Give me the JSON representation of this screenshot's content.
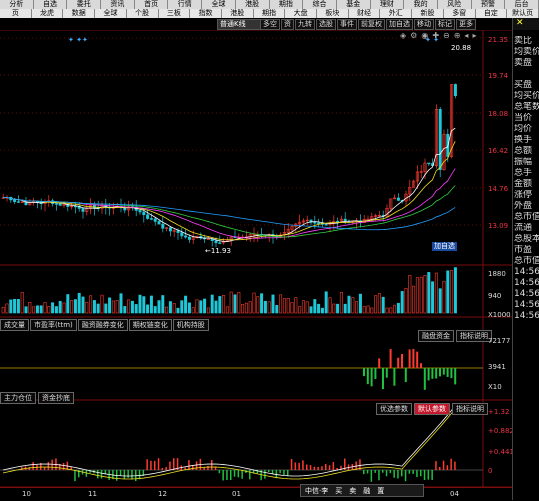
{
  "toolbar": {
    "row1": [
      "分析",
      "自选",
      "委托",
      "资讯",
      "首页",
      "行情",
      "全球",
      "港股",
      "期指",
      "综合",
      "基金",
      "理财",
      "我的",
      "风险",
      "预警",
      "后台"
    ],
    "row2": [
      "页",
      "龙虎",
      "数据",
      "全球",
      "个股",
      "三板",
      "指数",
      "港股",
      "期指",
      "大盘",
      "板块",
      "财经",
      "外汇",
      "新股",
      "多窗",
      "自定",
      "默认页"
    ]
  },
  "chart_tabs": {
    "period_select": "普通K线",
    "tabs": [
      "多空",
      "资",
      "九转",
      "选股",
      "事件",
      "前复权",
      "加自选",
      "移动",
      "标记",
      "更多"
    ],
    "icons": [
      "lock-icon",
      "gear-icon",
      "camera-icon",
      "crosshair-icon",
      "zoom-out-icon",
      "zoom-in-icon",
      "prev-icon",
      "next-icon"
    ]
  },
  "price_axis": [
    "21.35",
    "19.74",
    "18.08",
    "16.42",
    "14.76",
    "13.09"
  ],
  "volume_axis": [
    "1880",
    "940",
    "X1000"
  ],
  "indicator2_axis": [
    "72177",
    "3941",
    "X10"
  ],
  "indicator3_axis": [
    "+1.32",
    "+0.882",
    "+0.441",
    "0"
  ],
  "annotations": {
    "high": "20.88",
    "low": "11.93",
    "add_button": "加自选"
  },
  "indicator_tabs": {
    "left": [
      "成交量",
      "市盈率(ttm)",
      "融资融券变化",
      "期权链变化",
      "机构持股"
    ],
    "right": [
      "融盘资金",
      "指标说明"
    ]
  },
  "section2_tabs": {
    "left": [
      "主力仓位",
      "资金抄底"
    ]
  },
  "section3_tabs": {
    "right": [
      "优选参数",
      "默认参数",
      "指标说明"
    ]
  },
  "right_panel": [
    "卖比",
    "均卖价",
    "卖盘",
    "",
    "买盘",
    "均买价",
    "总笔数",
    "当价",
    "均价",
    "换手",
    "总额",
    "振幅",
    "总手",
    "金额",
    "涨停",
    "外盘",
    "总市值",
    "流通",
    "总股本",
    "市盈",
    "总市值",
    "14:56",
    "14:56",
    "14:56",
    "14:56",
    "14:56"
  ],
  "x_dates": [
    "10",
    "11",
    "12",
    "01",
    "04"
  ],
  "bottom_bar": [
    "中信·李",
    "买",
    "卖",
    "融",
    "置"
  ],
  "side_marks": [
    "1",
    "2"
  ],
  "colors": {
    "up": "#ff3b30",
    "down": "#1fc8d8",
    "ma1": "#ffffff",
    "ma2": "#f0e020",
    "ma3": "#ff40ff",
    "ma4": "#30d040",
    "ma5": "#20a0ff",
    "grid": "#7a0d0d"
  }
}
